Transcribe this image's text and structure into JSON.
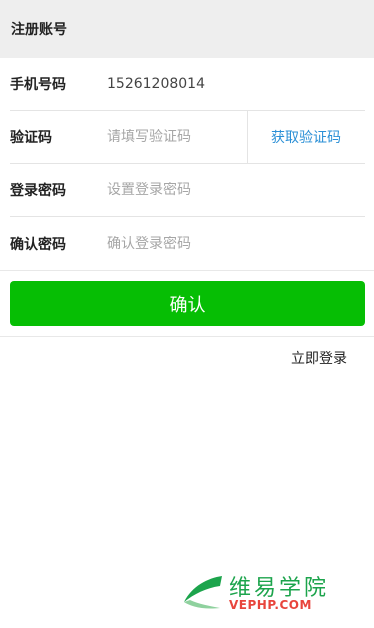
{
  "header": {
    "title": "注册账号"
  },
  "form": {
    "phone": {
      "label": "手机号码",
      "value": "15261208014"
    },
    "code": {
      "label": "验证码",
      "placeholder": "请填写验证码",
      "get_code_label": "获取验证码"
    },
    "password": {
      "label": "登录密码",
      "placeholder": "设置登录密码"
    },
    "confirm_password": {
      "label": "确认密码",
      "placeholder": "确认登录密码"
    },
    "confirm_button": "确认",
    "login_link": "立即登录"
  },
  "watermark": {
    "name": "维易学院",
    "url": "VEPHP.COM",
    "icon": "leaf-arrow-logo"
  },
  "colors": {
    "header_bg": "#eeeeee",
    "button_green": "#06be04",
    "link_blue": "#2a8fd6",
    "watermark_green": "#1ca44c",
    "watermark_red": "#e8453c"
  }
}
